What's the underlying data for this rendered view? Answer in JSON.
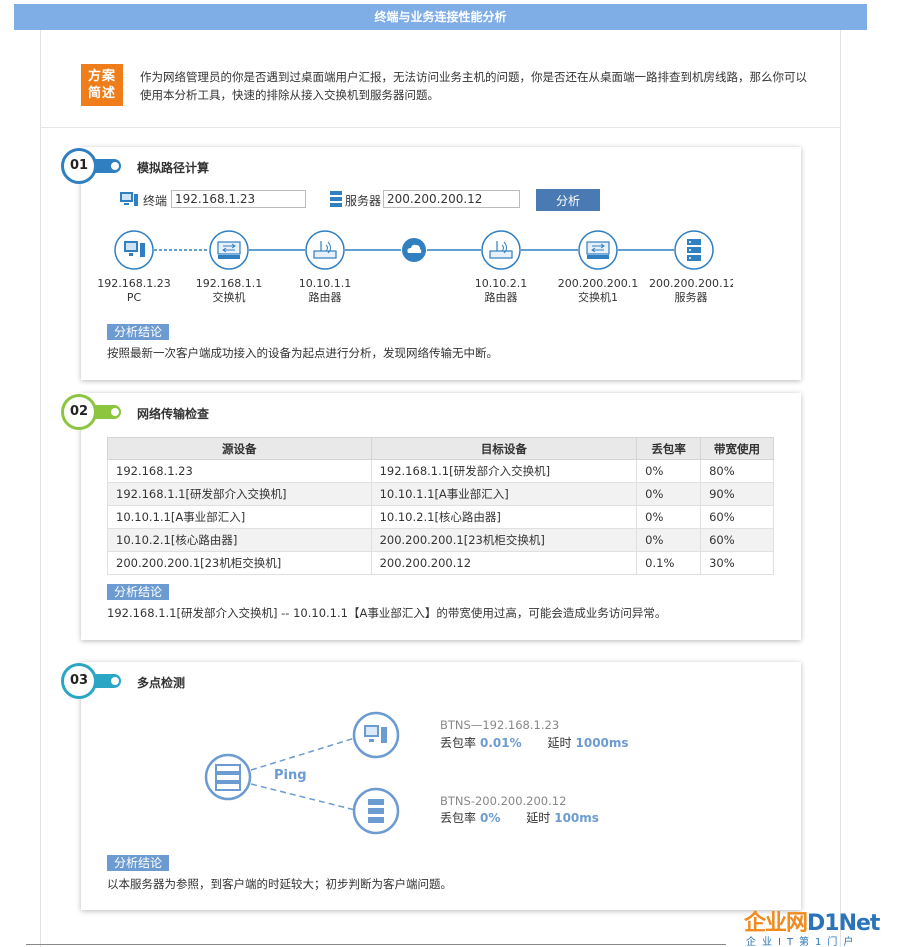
{
  "header": {
    "title": "终端与业务连接性能分析"
  },
  "intro": {
    "badge": [
      "方案",
      "简述"
    ],
    "text": "作为网络管理员的你是否遇到过桌面端用户汇报，无法访问业务主机的问题，你是否还在从桌面端一路排查到机房线路，那么你可以使用本分析工具，快速的排除从接入交换机到服务器问题。"
  },
  "section1": {
    "number": "01",
    "title": "模拟路径计算",
    "terminal_label": "终端",
    "terminal_value": "192.168.1.23",
    "server_label": "服务器",
    "server_value": "200.200.200.12",
    "analyze_button": "分析",
    "nodes": [
      {
        "icon": "pc-icon",
        "ip": "192.168.1.23",
        "type": "PC"
      },
      {
        "icon": "switch-icon",
        "ip": "192.168.1.1",
        "type": "交换机"
      },
      {
        "icon": "router-icon",
        "ip": "10.10.1.1",
        "type": "路由器"
      },
      {
        "icon": "cloud-icon",
        "ip": "",
        "type": ""
      },
      {
        "icon": "router-icon",
        "ip": "10.10.2.1",
        "type": "路由器"
      },
      {
        "icon": "switch-icon",
        "ip": "200.200.200.1",
        "type": "交换机1"
      },
      {
        "icon": "server-icon",
        "ip": "200.200.200.12",
        "type": "服务器"
      }
    ],
    "tag": "分析结论",
    "conclusion": "按照最新一次客户端成功接入的设备为起点进行分析，发现网络传输无中断。"
  },
  "section2": {
    "number": "02",
    "title": "网络传输检查",
    "columns": [
      "源设备",
      "目标设备",
      "丢包率",
      "带宽使用"
    ],
    "rows": [
      [
        "192.168.1.23",
        "192.168.1.1[研发部介入交换机]",
        "0%",
        "80%"
      ],
      [
        "192.168.1.1[研发部介入交换机]",
        "10.10.1.1[A事业部汇入]",
        "0%",
        "90%"
      ],
      [
        "10.10.1.1[A事业部汇入]",
        "10.10.2.1[核心路由器]",
        "0%",
        "60%"
      ],
      [
        "10.10.2.1[核心路由器]",
        "200.200.200.1[23机柜交换机]",
        "0%",
        "60%"
      ],
      [
        "200.200.200.1[23机柜交换机]",
        "200.200.200.12",
        "0.1%",
        "30%"
      ]
    ],
    "tag": "分析结论",
    "conclusion": "192.168.1.1[研发部介入交换机] -- 10.10.1.1【A事业部汇入】的带宽使用过高，可能会造成业务访问异常。"
  },
  "section3": {
    "number": "03",
    "title": "多点检测",
    "ping_label": "Ping",
    "targets": [
      {
        "name": "BTNS—192.168.1.23",
        "loss_label": "丢包率",
        "loss": "0.01%",
        "latency_label": "延时",
        "latency": "1000ms"
      },
      {
        "name": "BTNS-200.200.200.12",
        "loss_label": "丢包率",
        "loss": "0%",
        "latency_label": "延时",
        "latency": "100ms"
      }
    ],
    "tag": "分析结论",
    "conclusion": "以本服务器为参照，到客户端的时延较大；初步判断为客户端问题。"
  },
  "watermark": {
    "main": "企业网",
    "brand": "D1Net",
    "sub": "企业IT第1门户"
  },
  "colors": {
    "header": "#7faee6",
    "accent": "#6c9bd1",
    "badge_orange": "#ef7d1a",
    "button": "#4a7ab3"
  }
}
